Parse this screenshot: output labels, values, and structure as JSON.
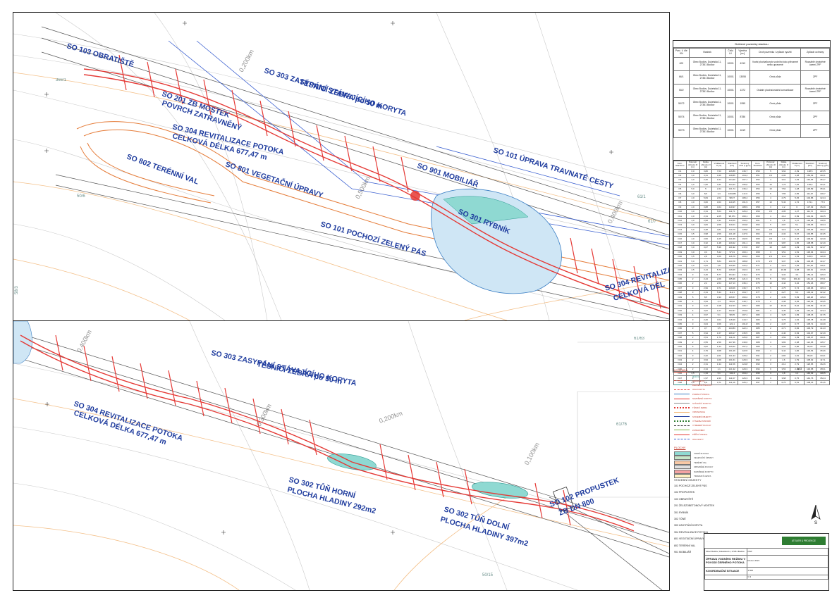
{
  "labels_top": [
    {
      "text": "SO 103 OBRATIŠTĚ"
    },
    {
      "text": "SO 303 ZASYPÁNÍ STÁVAJÍCÍHO KORYTA"
    },
    {
      "text": "TĚSNICÍ ZEBRA po 50 m"
    },
    {
      "text": "SO 201 ŽB MOSTEK"
    },
    {
      "text": "POVRCH ZATRAVNĚNÝ"
    },
    {
      "text": "SO 304 REVITALIZACE POTOKA"
    },
    {
      "text": "CELKOVÁ DÉLKA 677,47 m"
    },
    {
      "text": "SO 802 TERÉNNÍ VAL"
    },
    {
      "text": "SO 801 VEGETAČNÍ ÚPRAVY"
    },
    {
      "text": "SO 901 MOBILIÁŘ"
    },
    {
      "text": "SO 101 ÚPRAVA TRAVNATÉ CESTY"
    },
    {
      "text": "SO 301 RYBNÍK"
    },
    {
      "text": "SO 101 POCHOZÍ ZELENÝ PÁS"
    },
    {
      "text": "SO 304 REVITALIZACE"
    },
    {
      "text": "CELKOVÁ DÉL"
    }
  ],
  "labels_bottom": [
    {
      "text": "SO 303 ZASYPÁNÍ STÁVAJÍCÍHO KORYTA"
    },
    {
      "text": "TĚSNICÍ ZEBRA po 50 m"
    },
    {
      "text": "SO 304 REVITALIZACE POTOKA"
    },
    {
      "text": "CELKOVÁ DÉLKA 677,47 m"
    },
    {
      "text": "SO 302 TŮŇ HORNÍ"
    },
    {
      "text": "PLOCHA HLADINY 292m2"
    },
    {
      "text": "SO 302 TŮŇ DOLNÍ"
    },
    {
      "text": "PLOCHA HLADINY 397m2"
    },
    {
      "text": "SO 102 PROPUSTEK"
    },
    {
      "text": "ŽB DN 800"
    }
  ],
  "stationing_top": [
    "0,200km",
    "0,500km",
    "0,400km"
  ],
  "stationing_bottom": [
    "0,400km",
    "0,300km",
    "0,200km",
    "0,100km"
  ],
  "parcels_top": [
    "366/1",
    "50/6",
    "61/1",
    "61/7",
    "58/3"
  ],
  "parcels_bottom": [
    "61/63",
    "61/76",
    "50/15"
  ],
  "ownership": {
    "title": "Dotčené pozemky stavbou",
    "headers": [
      "Parc. č. dle KN",
      "Vlastník",
      "Číslo LV",
      "Výměra [m²]",
      "Druh pozemku / způsob využití",
      "Způsob ochrany"
    ],
    "rows": [
      [
        "400",
        "Obec Bodlov, Dukelská 11, 27351 Bodlov",
        "10001",
        "4310",
        "Vodní plocha/koryto vodního toku přirozené nebo upravené",
        "Rozsáhlé chráněné území ZPF"
      ],
      [
        "66/1",
        "Obec Bodlov, Dukelská 11, 27351 Bodlov",
        "10001",
        "13055",
        "Orná půda",
        "ZPF"
      ],
      [
        "50/2",
        "Obec Bodlov, Dukelská 11, 27351 Bodlov",
        "10001",
        "1372",
        "Ostatní plocha/ostatní komunikace",
        "Rozsáhlé chráněné území ZPF"
      ],
      [
        "50/72",
        "Obec Bodlov, Dukelská 11, 27351 Bodlov",
        "10001",
        "1955",
        "Orná půda",
        "ZPF"
      ],
      [
        "50/74",
        "Obec Bodlov, Dukelská 11, 27351 Bodlov",
        "10001",
        "8786",
        "Orná půda",
        "ZPF"
      ],
      [
        "50/73",
        "Obec Bodlov, Dukelská 11, 27351 Bodlov",
        "10001",
        "1619",
        "Orná půda",
        "ZPF"
      ]
    ]
  },
  "coords": {
    "headers": [
      "Kom. Staničení",
      "Poloměr oblouku R [m]",
      "Délka oblouku O [m]",
      "Vzdálenost P [m]",
      "Staničení [km]",
      "Směrový úhel φ [gon]"
    ],
    "rows": [
      [
        "O1",
        "6,0",
        "3,80",
        "7,03",
        "126,89",
        "136,7",
        "O50",
        "5",
        "3,62",
        "2,39",
        "138,5",
        "215,5"
      ],
      [
        "O2",
        "3,0",
        "3,31",
        "3,46",
        "138,85",
        "164,4",
        "O51",
        "3,5",
        "2,95",
        "1,48",
        "150,93",
        "140,1"
      ],
      [
        "O3",
        "2,0",
        "2,30",
        "1,54",
        "144,40",
        "167,7",
        "O52",
        "4",
        "3,61",
        "1,53",
        "142,65",
        "181,7"
      ],
      [
        "O4",
        "2,0",
        "1,90",
        "4,31",
        "123,43",
        "195,6",
        "O53",
        "10",
        "7,76",
        "7,52",
        "139,6",
        "191,1"
      ],
      [
        "O5",
        "5,0",
        "5",
        "2,44",
        "121,74",
        "136,4",
        "O54",
        "10",
        "7,52",
        "1,48",
        "136,89",
        "153,1"
      ],
      [
        "O6",
        "3,0",
        "8,5",
        "3,3",
        "109,886",
        "117,6",
        "O55",
        "5",
        "7,55",
        "2,55",
        "111,97",
        "136,7"
      ],
      [
        "O7",
        "4,0",
        "5,09",
        "2,64",
        "98,07",
        "189,4",
        "O56",
        "4",
        "2,79",
        "5,45",
        "102,86",
        "124,4"
      ],
      [
        "O8",
        "4,0",
        "3,60",
        "3,03",
        "110,45",
        "161,9",
        "O57",
        "10",
        "5,43",
        "1,72",
        "173,1",
        "77,6"
      ],
      [
        "O9",
        "4,0",
        "3,88",
        "4,64",
        "110,97",
        "188,9",
        "O58",
        "3",
        "2,2",
        "6",
        "137,93",
        "152,9"
      ],
      [
        "O10",
        "3,0",
        "2,31",
        "5,64",
        "111,71",
        "126,4",
        "O59",
        "3,5",
        "4,05",
        "1,47",
        "111,72",
        "132,4"
      ],
      [
        "O11",
        "2,0",
        "2,31",
        "2,25",
        "98,071",
        "160,1",
        "O60",
        "4",
        "4,12",
        "0,99",
        "101,01",
        "140,5"
      ],
      [
        "O12",
        "4,0",
        "2,58",
        "4,31",
        "110,59",
        "193,2",
        "O61",
        "5",
        "4,6",
        "1,47",
        "136,98",
        "138,9"
      ],
      [
        "O13",
        "3,0",
        "4,06",
        "2,59",
        "110,21",
        "164,8",
        "O62",
        "5",
        "4,97",
        "5,1",
        "139,96",
        "146,4"
      ],
      [
        "O14",
        "5,0",
        "3,38",
        "4,81",
        "110,79",
        "128,8",
        "O63",
        "3,5",
        "3,19",
        "2,23",
        "106,66",
        "140,7"
      ],
      [
        "O15",
        "3,5",
        "3,98",
        "2,56",
        "121,18",
        "147,9",
        "O64",
        "3,5",
        "2,32",
        "5,07",
        "102,85",
        "143,5"
      ],
      [
        "O16",
        "4,0",
        "2,50",
        "1,65",
        "121,69",
        "162,5",
        "O65",
        "3,5",
        "2,4",
        "2,16",
        "106,82",
        "122,9"
      ],
      [
        "O17",
        "3,0",
        "3,32",
        "1,48",
        "129,42",
        "161,1",
        "O66",
        "4,5",
        "3,87",
        "1,65",
        "108,58",
        "121,9"
      ],
      [
        "O18",
        "3,0",
        "3,07",
        "5,39",
        "141,92",
        "172,6",
        "O67",
        "10",
        "4,28",
        "1,49",
        "132,51",
        "121,7"
      ],
      [
        "O19",
        "3,0",
        "3,3",
        "5,44",
        "97,01",
        "163,1",
        "O68",
        "3",
        "3,51",
        "1,51",
        "136,64",
        "134,4"
      ],
      [
        "O20",
        "3,5",
        "2,8",
        "3,26",
        "116,79",
        "164,2",
        "O69",
        "2,5",
        "3,11",
        "1,53",
        "106,8",
        "120,9"
      ],
      [
        "O21",
        "5,0",
        "4,71",
        "5,84",
        "130,78",
        "188,8",
        "O70",
        "2,5",
        "3,07",
        "1,89",
        "106,08",
        "143,7"
      ],
      [
        "O22",
        "2,0",
        "2,91",
        "3,8",
        "129,39",
        "122,2",
        "O71",
        "2",
        "2,19",
        "1,69",
        "111,45",
        "130,1"
      ],
      [
        "O23",
        "2,5",
        "3,44",
        "5,73",
        "146,06",
        "162,3",
        "O72",
        "10",
        "18,93",
        "6,58",
        "116,61",
        "170,5"
      ],
      [
        "O24",
        "3",
        "3,46",
        "5,77",
        "154,34",
        "116,4",
        "O73",
        "4",
        "3,34",
        "4,6",
        "156,41",
        "126,3"
      ],
      [
        "O25",
        "2",
        "2,44",
        "2,29",
        "135,46",
        "121,3",
        "O74",
        "5",
        "3,64",
        "151,44",
        "141,21",
        "170,1"
      ],
      [
        "O26",
        "2",
        "2,2",
        "2,64",
        "117,13",
        "136,1",
        "O75",
        "10",
        "4,44",
        "3,22",
        "151,26",
        "165,7"
      ],
      [
        "O27",
        "3",
        "2,99",
        "0,71",
        "129,06",
        "136,7",
        "O76",
        "5",
        "4,75",
        "6,74",
        "136,96",
        "145,4"
      ],
      [
        "O28",
        "3",
        "2,31",
        "5,34",
        "112,1",
        "164,7",
        "O77",
        "4",
        "2,27",
        "6,3",
        "133,12",
        "121,2"
      ],
      [
        "O29",
        "5",
        "8,5",
        "3,33",
        "136,57",
        "160,2",
        "O78",
        "2",
        "2,39",
        "5,83",
        "118,26",
        "139,3"
      ],
      [
        "O30",
        "4",
        "3,93",
        "4,4",
        "99,02",
        "149,7",
        "O79",
        "2",
        "2,38",
        "3,25",
        "120,63",
        "149,5"
      ],
      [
        "O31",
        "3",
        "4,32",
        "3,18",
        "112,33",
        "105,7",
        "O80",
        "12",
        "18,41",
        "8,42",
        "139,99",
        "141,6"
      ],
      [
        "O32",
        "4",
        "4,02",
        "2,17",
        "102,97",
        "154,9",
        "O81",
        "3",
        "3,45",
        "1,99",
        "142,19",
        "123,4"
      ],
      [
        "O33",
        "4",
        "3,97",
        "5,1",
        "98,05",
        "167,1",
        "O82",
        "4",
        "3,25",
        "1,83",
        "138,15",
        "147,5"
      ],
      [
        "O34",
        "3",
        "2,26",
        "3,04",
        "116,99",
        "144,7",
        "O83",
        "4",
        "3,75",
        "1,54",
        "135,78",
        "144,8"
      ],
      [
        "O35",
        "3",
        "3,04",
        "3,06",
        "121,1",
        "161,8",
        "O84",
        "2",
        "2,37",
        "0,77",
        "105,71",
        "134,9"
      ],
      [
        "O36",
        "3",
        "3,7",
        "3,5",
        "133,83",
        "122,1",
        "O85",
        "2",
        "2,71",
        "0,84",
        "106,79",
        "141,3"
      ],
      [
        "O37",
        "5",
        "3,94",
        "1,67",
        "109,17",
        "135,5",
        "O86",
        "3",
        "2,46",
        "0,93",
        "104,97",
        "121,9"
      ],
      [
        "O38",
        "2",
        "2,51",
        "1,73",
        "111,21",
        "125,6",
        "O87",
        "3",
        "4,59",
        "1,39",
        "135,07",
        "140,1"
      ],
      [
        "O39",
        "2",
        "2,55",
        "2,59",
        "147,36",
        "130,6",
        "O88",
        "3",
        "3,83",
        "2,38",
        "121,05",
        "135,7"
      ],
      [
        "O40",
        "6",
        "4,02",
        "1,34",
        "145,62",
        "157,2",
        "O89",
        "4",
        "3,92",
        "0,86",
        "95,23",
        "103,8"
      ],
      [
        "O41",
        "4",
        "2,79",
        "0,68",
        "101,26",
        "122,5",
        "O90",
        "4",
        "3,44",
        "1,82",
        "132,54",
        "153,6"
      ],
      [
        "O42",
        "3",
        "2,32",
        "2,01",
        "121,34",
        "129,2",
        "O91",
        "2",
        "2,84",
        "1,51",
        "95,23",
        "104,1"
      ],
      [
        "O43",
        "2",
        "3,93",
        "3,29",
        "131,61",
        "129,3",
        "O92",
        "2",
        "2,6",
        "1,79",
        "105,02",
        "117,1"
      ],
      [
        "O44",
        "2",
        "2,31",
        "1,34",
        "111,56",
        "124,8",
        "O93",
        "3",
        "4,12",
        "2,79",
        "126,65",
        "162,6"
      ],
      [
        "O45",
        "2",
        "2,34",
        "1,1",
        "121,32",
        "129,3",
        "O94",
        "6",
        "3,53",
        "2,29",
        "130,58",
        "155,1"
      ],
      [
        "O46",
        "2,5",
        "1,34",
        "5,1",
        "141,4",
        "164,4",
        "O95",
        "3",
        "4,8",
        "1,3",
        "140,93",
        "136,5"
      ],
      [
        "O47",
        "3",
        "1,97",
        "2,43",
        "111,67",
        "126,3",
        "O96",
        "3",
        "3,68",
        "0,75",
        "144,76",
        "152,4"
      ],
      [
        "O48",
        "2,5",
        "2,9",
        "3,71",
        "111,16",
        "126,1",
        "O97",
        "7",
        "6,75",
        "6,51",
        "108,15",
        "151,6"
      ]
    ],
    "total": "0,53"
  },
  "legend": {
    "title": "LEGENDA",
    "parcel_code": "50/21",
    "items": [
      "HRANICE KN",
      "PARCELNÍ ČÍSLA KN",
      "OSA KORYTA",
      "PODÉLNÝ PROFIL",
      "NAVRŽENÉ KORYTO",
      "STÁVAJÍCÍ KORYTO",
      "TĚSNICÍ ZEBRA",
      "VRSTEVNICE",
      "STAVEBNÍ OBJEKTY",
      "VÝSADBA STROMŮ",
      "VYMEZENÍ PLOCHY",
      "ZATRAVNĚNÍ",
      "PŘÍČNÝ PROFIL",
      "OSA CESTY"
    ],
    "area_title": "PLOCHY",
    "area_items": [
      "VODNÍ PLOCHA",
      "VEGETAČNÍ ÚPRAVY",
      "TERÉNNÍ VAL",
      "ZPEVNĚNÉ PLOCHY",
      "NAVRŽENÉ KORYTO",
      "TRAVNATÁ CESTA"
    ]
  },
  "objects": {
    "title": "STAVEBNÍ OBJEKTY",
    "items": [
      "101 POCHOZÍ ZELENÝ PÁS",
      "102 PROPUSTEK",
      "103 OBRATIŠTĚ",
      "201 ŽELEZOBETONOVÝ MOSTEK",
      "301 RYBNÍK",
      "302 TŮNĚ",
      "303 ZASYPÁNÍ KORYTA",
      "304 REVITALIZACE POTOKA",
      "801 VEGETAČNÍ ÚPRAVY",
      "802 TERÉNNÍ VAL",
      "901 MOBILIÁŘ"
    ]
  },
  "title_block": {
    "logo": "ATELIER & PROJEKCE",
    "investor": "Obec Bodlov, Dukelská 11, 27351 Bodlov",
    "project": "ÚPRAVA VODNÍHO REŽIMU V POVODÍ ČERNÉHO POTOKA",
    "drawing": "KOORDINAČNÍ SITUACE",
    "date": "březen 2021",
    "scale": "1:500",
    "stage": "DSP",
    "sheet": "C.3"
  }
}
